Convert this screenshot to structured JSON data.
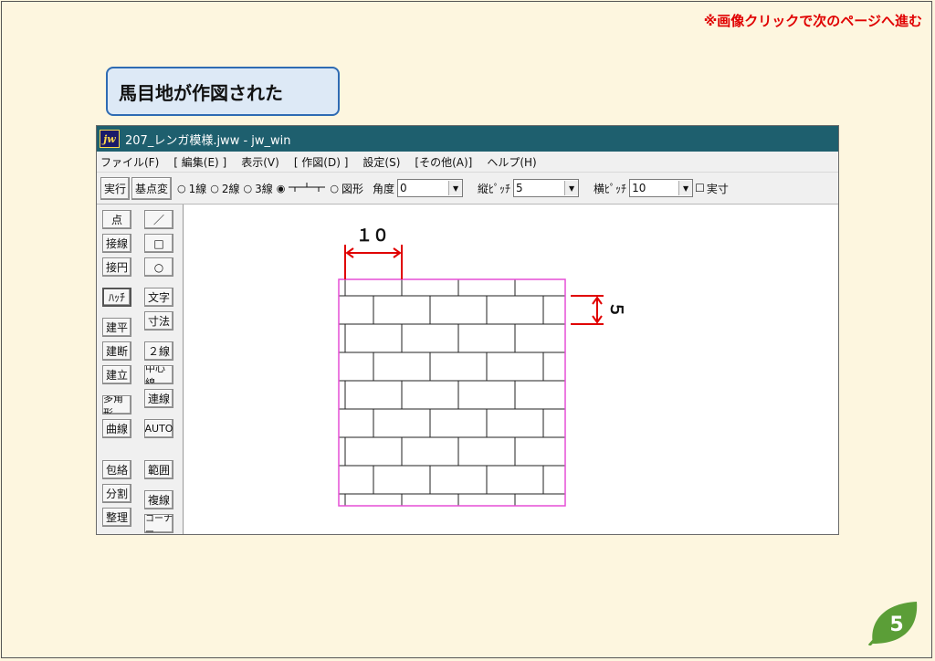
{
  "top_note": "※画像クリックで次のページへ進む",
  "callout": "馬目地が作図された",
  "window": {
    "title": "207_レンガ模様.jww - jw_win",
    "logo": "jw"
  },
  "menu": [
    "ファイル(F)",
    "[ 編集(E) ]",
    "表示(V)",
    "[ 作図(D) ]",
    "設定(S)",
    "[その他(A)]",
    "ヘルプ(H)"
  ],
  "toolbar": {
    "exec": "実行",
    "basepoint": "基点変",
    "radio1": "1線",
    "radio2": "2線",
    "radio3": "3線",
    "radio4": "図形",
    "angle_label": "角度",
    "angle_value": "0",
    "vpitch_label": "縦ﾋﾟｯﾁ",
    "vpitch_value": "5",
    "hpitch_label": "横ﾋﾟｯﾁ",
    "hpitch_value": "10",
    "check_label": "実寸"
  },
  "left_buttons": {
    "col1": [
      "点",
      "接線",
      "接円",
      "ﾊｯﾁ",
      "建平",
      "建断",
      "建立",
      "多角形",
      "曲線",
      "包絡",
      "分割",
      "整理"
    ],
    "col2": [
      "／",
      "□",
      "○",
      "文字",
      "寸法",
      "２線",
      "中心線",
      "連線",
      "AUTO",
      "範囲",
      "複線",
      "コーナー"
    ]
  },
  "drawing": {
    "dim_width": "１０",
    "dim_height": "５"
  },
  "colors": {
    "note": "#e00000",
    "callout_border": "#2f6bb3",
    "titlebar": "#1e5f6e",
    "dimension": "#e00000",
    "hatch_frame": "#e64fd6",
    "brick_line": "#222222"
  },
  "page_number": "5"
}
